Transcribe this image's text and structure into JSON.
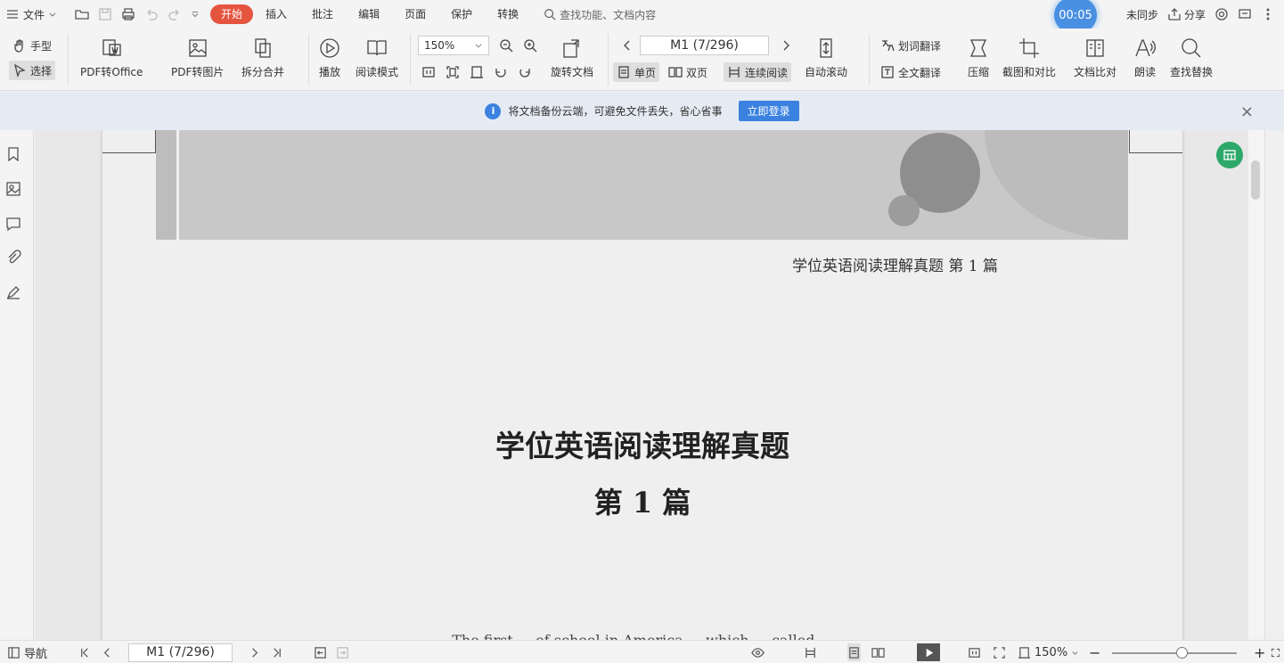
{
  "topbar": {
    "file_label": "文件",
    "tabs": [
      "开始",
      "插入",
      "批注",
      "编辑",
      "页面",
      "保护",
      "转换"
    ],
    "search_placeholder": "查找功能、文档内容",
    "timer": "00:05",
    "sync": "未同步",
    "share": "分享"
  },
  "ribbon": {
    "hand": "手型",
    "select": "选择",
    "pdf_office": "PDF转Office",
    "pdf_image": "PDF转图片",
    "split_merge": "拆分合并",
    "play": "播放",
    "read_mode": "阅读模式",
    "zoom": "150%",
    "page_indicator": "M1 (7/296)",
    "rotate": "旋转文档",
    "single": "单页",
    "double": "双页",
    "continuous": "连续阅读",
    "autoscroll": "自动滚动",
    "word_translate": "划词翻译",
    "full_translate": "全文翻译",
    "compress": "压缩",
    "screenshot": "截图和对比",
    "compare": "文档比对",
    "read_aloud": "朗读",
    "find_replace": "查找替换"
  },
  "notice": {
    "message": "将文档备份云端，可避免文件丢失，省心省事",
    "login": "立即登录"
  },
  "document": {
    "header": "学位英语阅读理解真题 第 1 篇",
    "title": "学位英语阅读理解真题",
    "subtitle": "第 1 篇",
    "body_snippet": "The first ... of school in America ... which ... called ..."
  },
  "statusbar": {
    "nav": "导航",
    "page_indicator": "M1 (7/296)",
    "zoom": "150%",
    "zoom_level": 0.56
  },
  "colors": {
    "accent": "#e5543f",
    "blue": "#3b82e0",
    "fab": "#2ea86a"
  }
}
